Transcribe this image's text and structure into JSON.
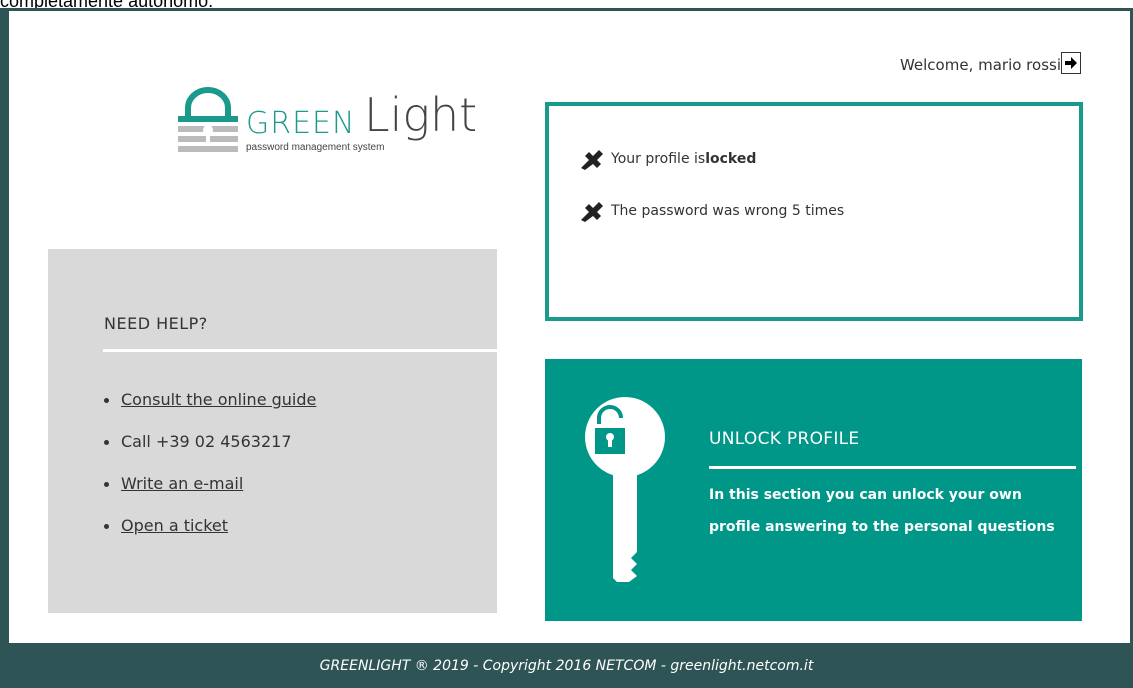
{
  "top_cut_text": "completamente autonomo.",
  "header": {
    "welcome_text": "Welcome, mario rossi",
    "logout_icon": "logout-icon"
  },
  "logo": {
    "word1": "GREEN",
    "word2": "Light",
    "subtitle": "password management system"
  },
  "help": {
    "title": "NEED HELP?",
    "items": [
      {
        "label": "Consult the online guide",
        "link": true
      },
      {
        "label": "Call +39 02 4563217",
        "link": false
      },
      {
        "label": "Write an e-mail",
        "link": true
      },
      {
        "label": "Open a ticket",
        "link": true
      }
    ]
  },
  "status": {
    "line1_prefix": "Your profile is ",
    "line1_bold": "locked",
    "line2": "The password was wrong 5 times",
    "icon": "pushpin-icon"
  },
  "unlock": {
    "title": "UNLOCK PROFILE",
    "description": "In this section you can unlock your own profile answering to the personal questions",
    "icon": "key-unlock-icon"
  },
  "footer": {
    "text": "GREENLIGHT ® 2019 - Copyright 2016 NETCOM - greenlight.netcom.it"
  },
  "colors": {
    "accent": "#009688",
    "frame": "#2f5455",
    "help_bg": "#d9d9d9"
  }
}
